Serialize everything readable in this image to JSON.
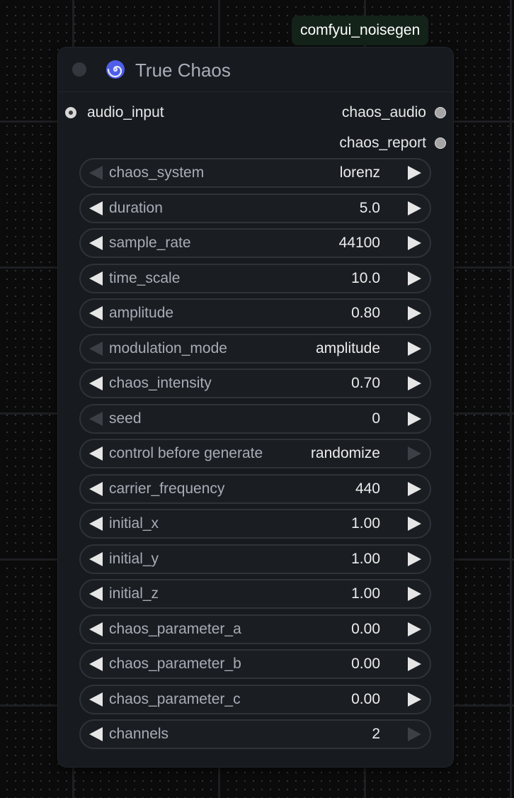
{
  "group": {
    "label": "comfyui_noisegen"
  },
  "node": {
    "title": "True Chaos",
    "icon": "spiral-icon",
    "colors": {
      "accent": "#5b6cf2",
      "background": "#171a1f"
    },
    "inputs": [
      {
        "label": "audio_input"
      }
    ],
    "outputs": [
      {
        "label": "chaos_audio"
      },
      {
        "label": "chaos_report"
      }
    ],
    "widgets": [
      {
        "label": "chaos_system",
        "value": "lorenz",
        "left_enabled": false,
        "right_enabled": true
      },
      {
        "label": "duration",
        "value": "5.0",
        "left_enabled": true,
        "right_enabled": true
      },
      {
        "label": "sample_rate",
        "value": "44100",
        "left_enabled": true,
        "right_enabled": true
      },
      {
        "label": "time_scale",
        "value": "10.0",
        "left_enabled": true,
        "right_enabled": true
      },
      {
        "label": "amplitude",
        "value": "0.80",
        "left_enabled": true,
        "right_enabled": true
      },
      {
        "label": "modulation_mode",
        "value": "amplitude",
        "left_enabled": false,
        "right_enabled": true
      },
      {
        "label": "chaos_intensity",
        "value": "0.70",
        "left_enabled": true,
        "right_enabled": true
      },
      {
        "label": "seed",
        "value": "0",
        "left_enabled": false,
        "right_enabled": true
      },
      {
        "label": "control before generate",
        "value": "randomize",
        "left_enabled": true,
        "right_enabled": false
      },
      {
        "label": "carrier_frequency",
        "value": "440",
        "left_enabled": true,
        "right_enabled": true
      },
      {
        "label": "initial_x",
        "value": "1.00",
        "left_enabled": true,
        "right_enabled": true
      },
      {
        "label": "initial_y",
        "value": "1.00",
        "left_enabled": true,
        "right_enabled": true
      },
      {
        "label": "initial_z",
        "value": "1.00",
        "left_enabled": true,
        "right_enabled": true
      },
      {
        "label": "chaos_parameter_a",
        "value": "0.00",
        "left_enabled": true,
        "right_enabled": true
      },
      {
        "label": "chaos_parameter_b",
        "value": "0.00",
        "left_enabled": true,
        "right_enabled": true
      },
      {
        "label": "chaos_parameter_c",
        "value": "0.00",
        "left_enabled": true,
        "right_enabled": true
      },
      {
        "label": "channels",
        "value": "2",
        "left_enabled": true,
        "right_enabled": false
      }
    ]
  }
}
